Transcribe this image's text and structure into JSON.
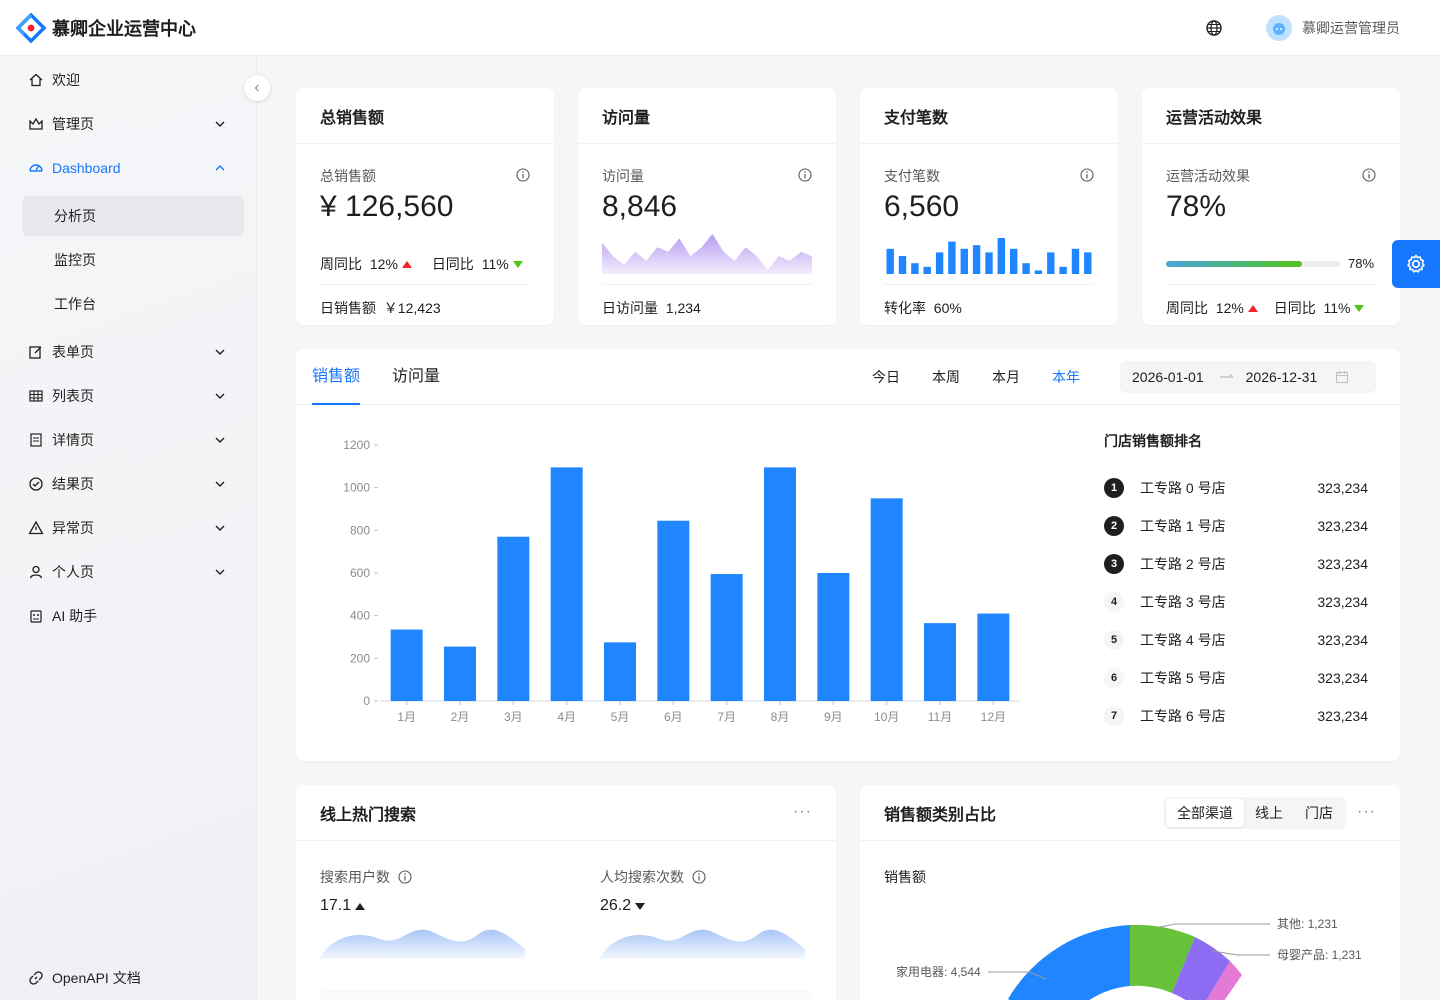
{
  "header": {
    "app_title": "慕卿企业运营中心",
    "username": "慕卿运营管理员"
  },
  "sidebar": {
    "items": [
      {
        "label": "欢迎",
        "icon": "home-icon"
      },
      {
        "label": "管理页",
        "icon": "crown-icon"
      },
      {
        "label": "Dashboard",
        "icon": "dashboard-icon"
      },
      {
        "label": "分析页"
      },
      {
        "label": "监控页"
      },
      {
        "label": "工作台"
      },
      {
        "label": "表单页",
        "icon": "form-icon"
      },
      {
        "label": "列表页",
        "icon": "table-icon"
      },
      {
        "label": "详情页",
        "icon": "profile-icon"
      },
      {
        "label": "结果页",
        "icon": "check-circle-icon"
      },
      {
        "label": "异常页",
        "icon": "warning-icon"
      },
      {
        "label": "个人页",
        "icon": "user-icon"
      },
      {
        "label": "AI 助手",
        "icon": "robot-icon"
      }
    ],
    "footer_link": "OpenAPI 文档"
  },
  "stats": [
    {
      "title": "总销售额",
      "label": "总销售额",
      "value": "¥ 126,560",
      "week_label": "周同比",
      "week_value": "12%",
      "day_label": "日同比",
      "day_value": "11%",
      "footer_label": "日销售额",
      "footer_value": "￥12,423"
    },
    {
      "title": "访问量",
      "label": "访问量",
      "value": "8,846",
      "footer_label": "日访问量",
      "footer_value": "1,234"
    },
    {
      "title": "支付笔数",
      "label": "支付笔数",
      "value": "6,560",
      "footer_label": "转化率",
      "footer_value": "60%"
    },
    {
      "title": "运营活动效果",
      "label": "运营活动效果",
      "value": "78%",
      "progress": 0.78,
      "progress_label": "78%",
      "week_label": "周同比",
      "week_value": "12%",
      "day_label": "日同比",
      "day_value": "11%"
    }
  ],
  "visits_area": [
    7,
    4,
    2,
    5,
    3,
    6,
    5,
    8,
    4,
    6,
    9,
    5,
    3,
    6,
    4,
    1,
    4,
    3,
    5,
    4
  ],
  "payments_bars": [
    7,
    5,
    3,
    2,
    6,
    9,
    7,
    8,
    6,
    10,
    7,
    3,
    1,
    6,
    2,
    7,
    6
  ],
  "sales": {
    "tabs": [
      "销售额",
      "访问量"
    ],
    "ranges": [
      "今日",
      "本周",
      "本月",
      "本年"
    ],
    "active_range": "本年",
    "date_start": "2026-01-01",
    "date_end": "2026-12-31",
    "rank_title": "门店销售额排名",
    "ranks": [
      {
        "no": "1",
        "name": "工专路 0 号店",
        "value": "323,234"
      },
      {
        "no": "2",
        "name": "工专路 1 号店",
        "value": "323,234"
      },
      {
        "no": "3",
        "name": "工专路 2 号店",
        "value": "323,234"
      },
      {
        "no": "4",
        "name": "工专路 3 号店",
        "value": "323,234"
      },
      {
        "no": "5",
        "name": "工专路 4 号店",
        "value": "323,234"
      },
      {
        "no": "6",
        "name": "工专路 5 号店",
        "value": "323,234"
      },
      {
        "no": "7",
        "name": "工专路 6 号店",
        "value": "323,234"
      }
    ]
  },
  "chart_data": {
    "type": "bar",
    "categories": [
      "1月",
      "2月",
      "3月",
      "4月",
      "5月",
      "6月",
      "7月",
      "8月",
      "9月",
      "10月",
      "11月",
      "12月"
    ],
    "values": [
      335,
      255,
      770,
      1095,
      275,
      845,
      595,
      1095,
      600,
      950,
      365,
      410
    ],
    "ylim": [
      0,
      1200
    ],
    "yticks": [
      "0",
      "200",
      "400",
      "600",
      "800",
      "1000",
      "1200"
    ],
    "color": "#1f86ff"
  },
  "hot_search": {
    "title": "线上热门搜索",
    "more": "···",
    "metric1_label": "搜索用户数",
    "metric1_value": "17.1",
    "metric2_label": "人均搜索次数",
    "metric2_value": "26.2"
  },
  "category": {
    "title": "销售额类别占比",
    "segments": [
      "全部渠道",
      "线上",
      "门店"
    ],
    "active_segment": "全部渠道",
    "more": "···",
    "subtitle": "销售额",
    "pie_labels": [
      {
        "text": "其他: 1,231",
        "color": "#67c23a"
      },
      {
        "text": "母婴产品: 1,231",
        "color": "#8c6cf2"
      },
      {
        "text": "家用电器: 4,544",
        "color": "#1f86ff"
      }
    ]
  },
  "colors": {
    "accent": "#1677ff",
    "up": "#f5222d",
    "down": "#52c41a",
    "area": "#b79cf0"
  }
}
